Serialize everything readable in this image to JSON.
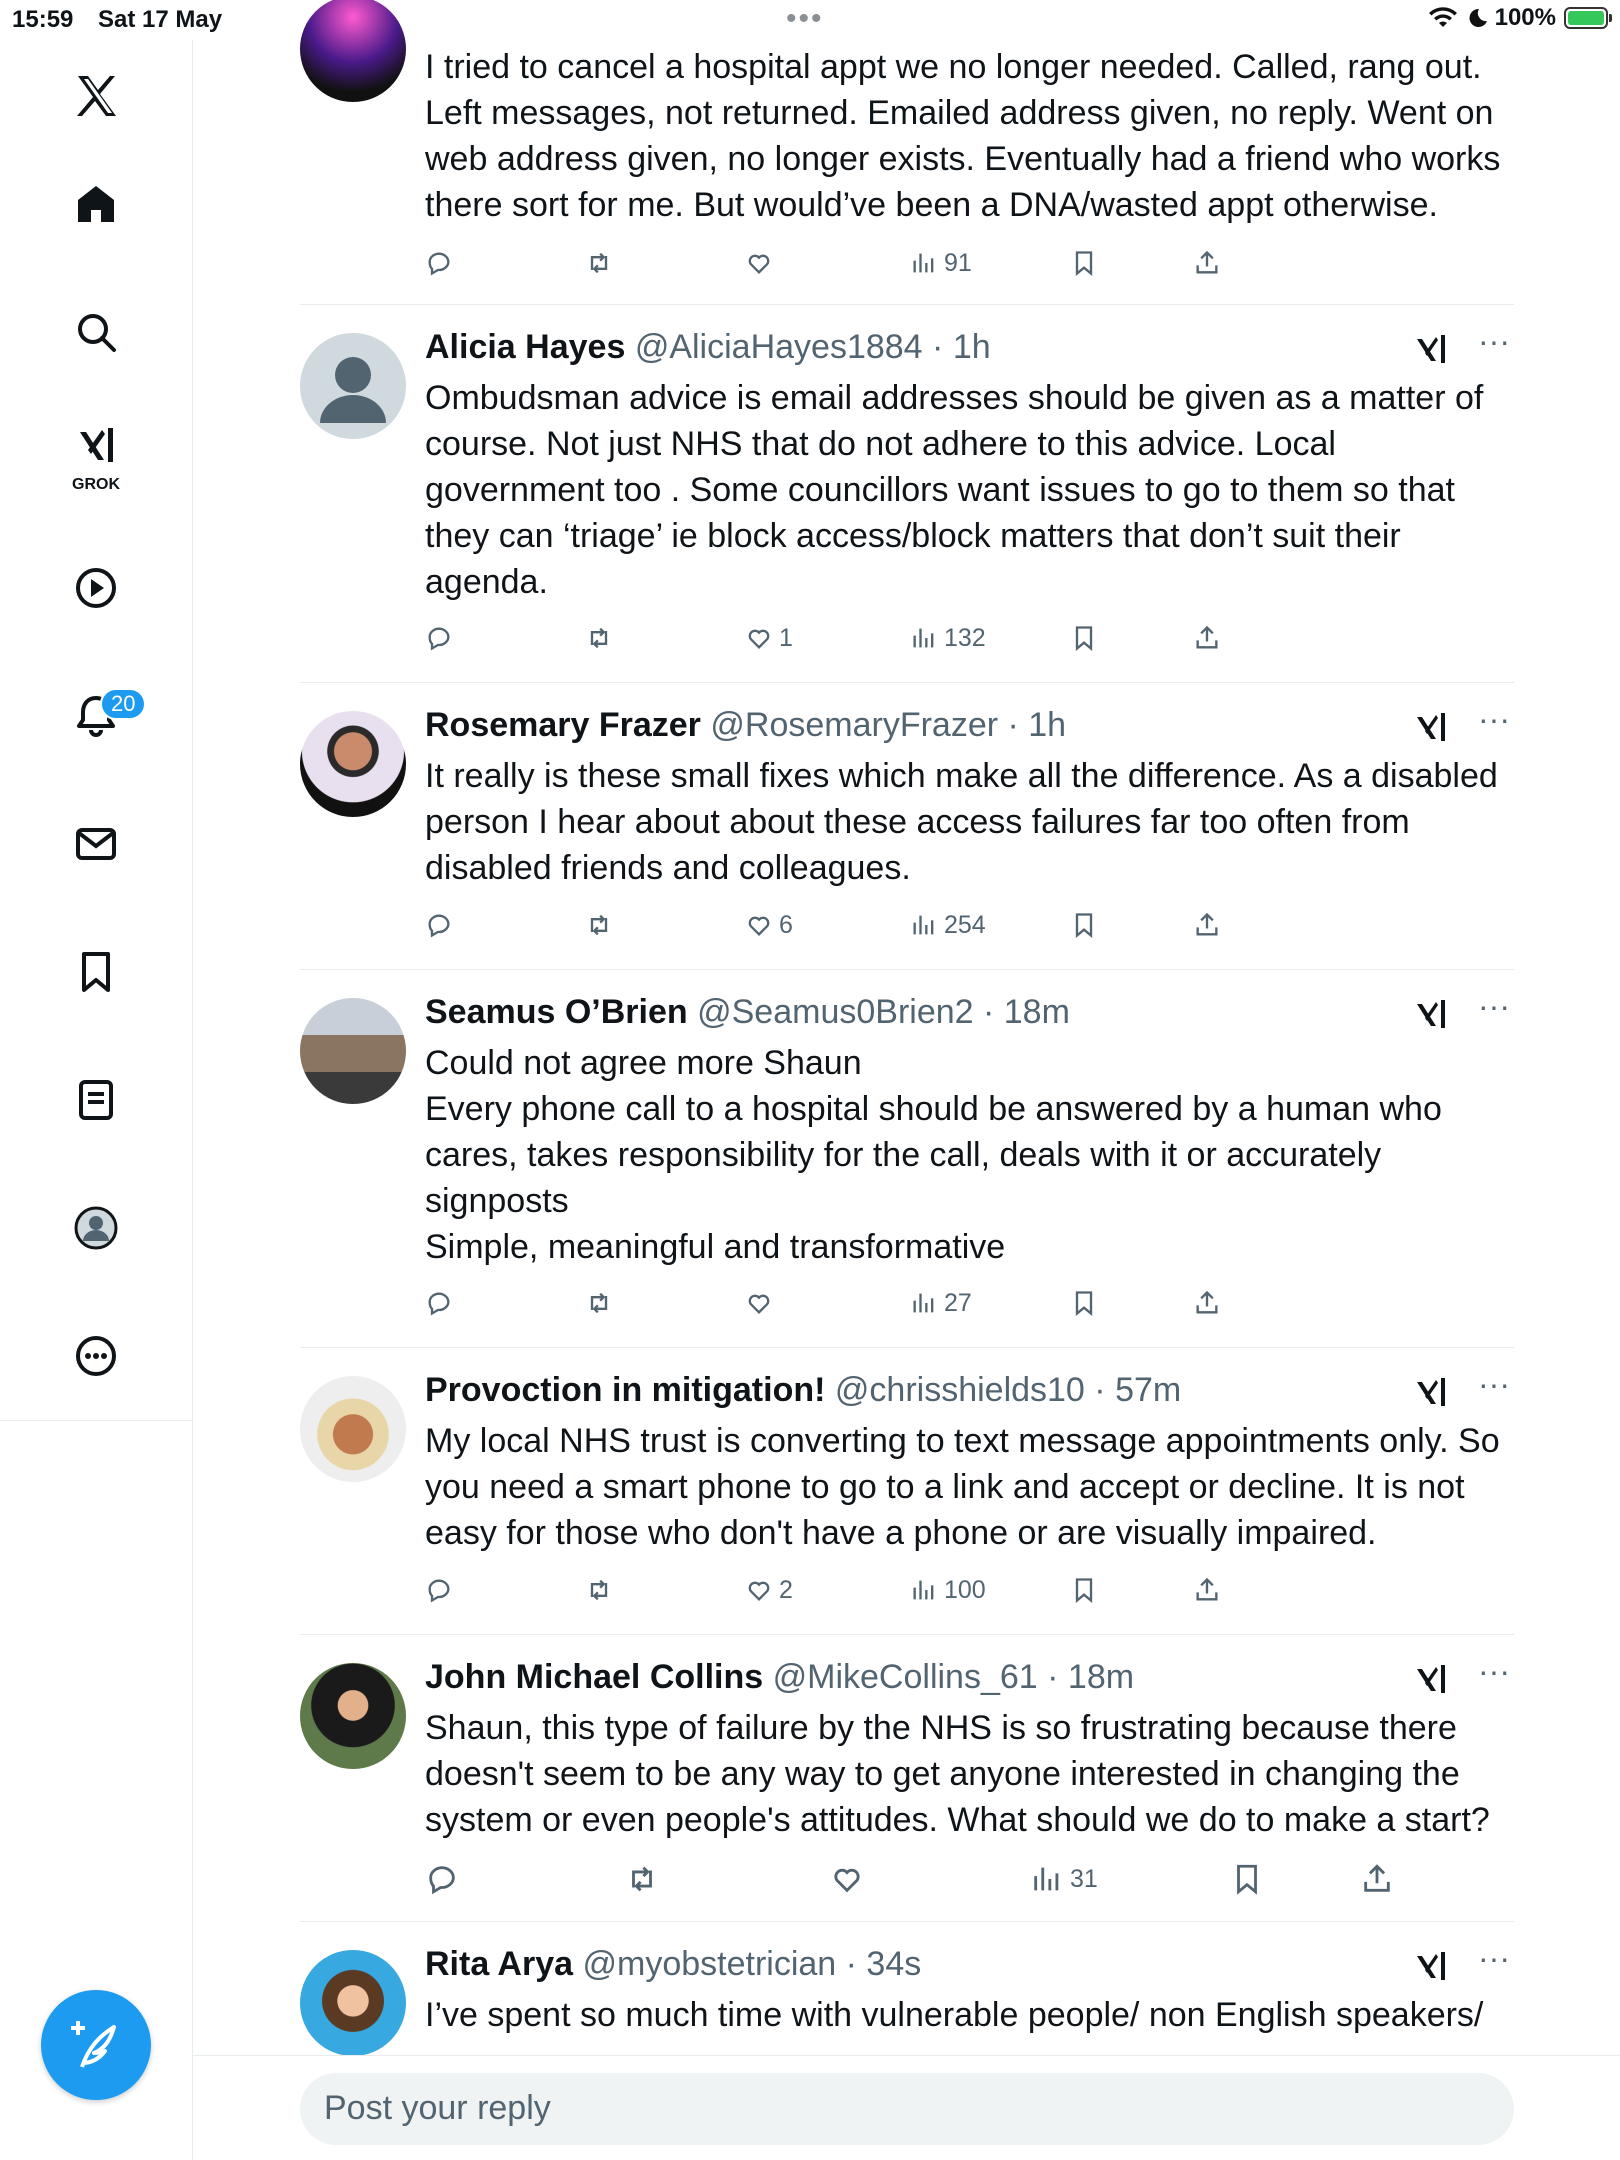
{
  "status": {
    "time": "15:59",
    "date": "Sat 17 May",
    "battery": "100%"
  },
  "sidebar": {
    "grok_label": "GROK",
    "notification_count": "20"
  },
  "tweets": [
    {
      "name": "",
      "handle": "",
      "time": "",
      "text": "I tried to cancel a hospital appt we no longer needed. Called, rang out. Left messages, not returned. Emailed address given, no reply. Went on web address given, no longer exists. Eventually had a friend who works there sort for me. But would’ve been a DNA/wasted appt otherwise.",
      "likes": "",
      "views": "91"
    },
    {
      "name": "Alicia Hayes",
      "handle": "@AliciaHayes1884",
      "time": "1h",
      "text": "Ombudsman advice is email addresses should be given as a matter of course. Not just NHS that do not adhere to this advice. Local government too . Some councillors want issues to go to them so that they can ‘triage’ ie block access/block matters that don’t suit their agenda.",
      "likes": "1",
      "views": "132"
    },
    {
      "name": "Rosemary Frazer",
      "handle": "@RosemaryFrazer",
      "time": "1h",
      "text": "It really is these small fixes which make all the difference. As a disabled person I hear about about these access failures far too often from disabled friends and colleagues.",
      "likes": "6",
      "views": "254"
    },
    {
      "name": "Seamus O’Brien",
      "handle": "@Seamus0Brien2",
      "time": "18m",
      "text": "Could not agree more Shaun\nEvery phone call to a hospital should be answered by a human who cares, takes responsibility for the call, deals with it or accurately signposts\nSimple, meaningful and transformative",
      "likes": "",
      "views": "27"
    },
    {
      "name": "Provoction in mitigation!",
      "handle": "@chrisshields10",
      "time": "57m",
      "text": "My local NHS trust is converting to text message appointments only. So you need a smart phone to go to a link and accept or decline. It is not easy for those who don't have a phone or are visually impaired.",
      "likes": "2",
      "views": "100"
    },
    {
      "name": "John Michael Collins",
      "handle": "@MikeCollins_61",
      "time": "18m",
      "text": "Shaun, this type of failure by the NHS is so frustrating because there doesn't seem to be any way to get anyone interested in changing the system or even people's attitudes. What should we do to make a start?",
      "likes": "",
      "views": "31"
    },
    {
      "name": "Rita Arya",
      "handle": "@myobstetrician",
      "time": "34s",
      "text": "I’ve spent so much time with vulnerable people/ non English speakers/",
      "likes": "",
      "views": ""
    }
  ],
  "reply": {
    "placeholder": "Post your reply"
  },
  "colors": {
    "accent": "#1d9bf0",
    "text": "#0f1419",
    "muted": "#536471"
  }
}
